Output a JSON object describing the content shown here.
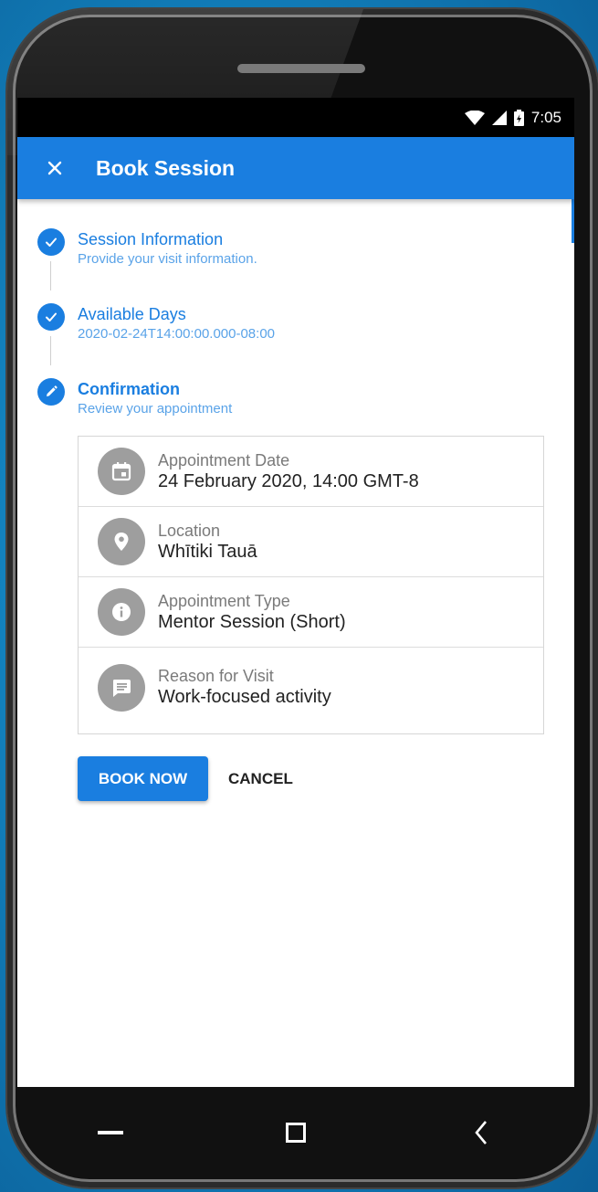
{
  "status_bar": {
    "time": "7:05",
    "icons": [
      "wifi-icon",
      "signal-icon",
      "battery-icon"
    ]
  },
  "app_bar": {
    "title": "Book Session",
    "close_icon": "close-icon"
  },
  "steps": [
    {
      "title": "Session Information",
      "subtitle": "Provide your visit information.",
      "icon": "check-icon",
      "state": "completed"
    },
    {
      "title": "Available Days",
      "subtitle": "2020-02-24T14:00:00.000-08:00",
      "icon": "check-icon",
      "state": "completed"
    },
    {
      "title": "Confirmation",
      "subtitle": "Review your appointment",
      "icon": "edit-icon",
      "state": "active"
    }
  ],
  "summary": [
    {
      "label": "Appointment Date",
      "value": "24 February 2020, 14:00 GMT-8",
      "icon": "calendar-icon"
    },
    {
      "label": "Location",
      "value": "Whītiki Tauā",
      "icon": "location-icon"
    },
    {
      "label": "Appointment Type",
      "value": "Mentor Session (Short)",
      "icon": "info-icon"
    },
    {
      "label": "Reason for Visit",
      "value": "Work-focused activity",
      "icon": "message-icon"
    }
  ],
  "actions": {
    "book_label": "BOOK NOW",
    "cancel_label": "CANCEL"
  },
  "colors": {
    "primary": "#1a7ee0",
    "icon_grey": "#9e9e9e"
  }
}
